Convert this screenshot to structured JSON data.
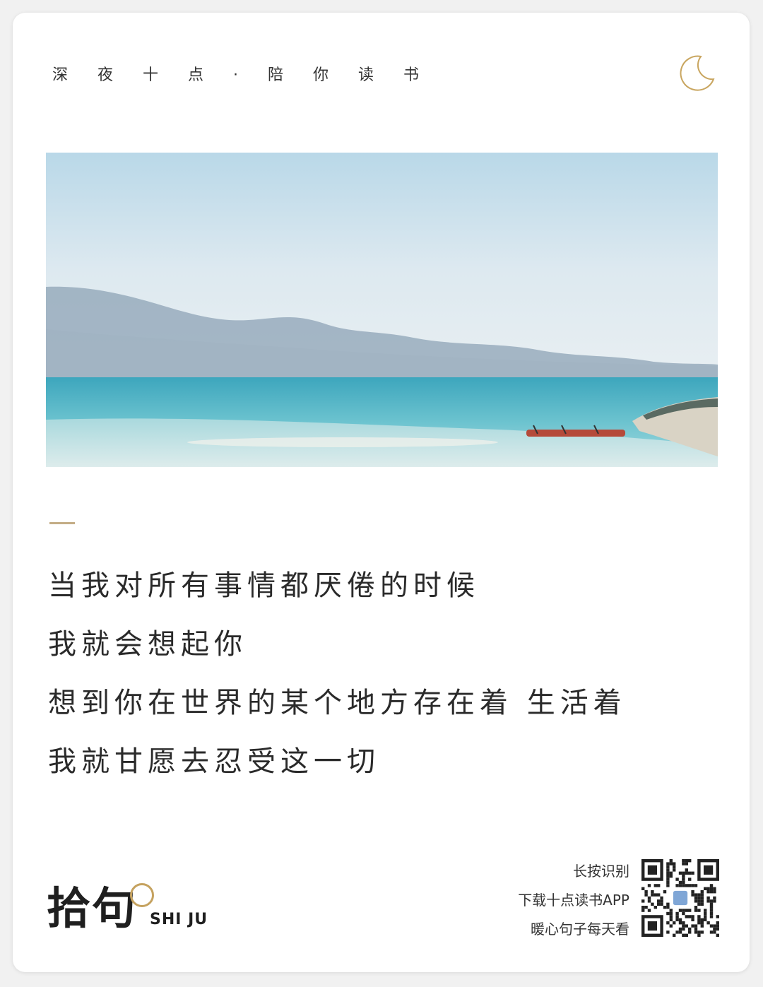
{
  "header": {
    "title": "深夜十点·陪你读书"
  },
  "quote": {
    "lines": [
      "当我对所有事情都厌倦的时候",
      "我就会想起你",
      "想到你在世界的某个地方存在着 生活着",
      "我就甘愿去忍受这一切"
    ]
  },
  "brand": {
    "name_cn": "拾句",
    "name_en": "SHI JU"
  },
  "qr_section": {
    "lines": [
      "长按识别",
      "下载十点读书APP",
      "暖心句子每天看"
    ]
  },
  "icons": {
    "moon": "moon-icon",
    "qr": "qr-code-icon"
  },
  "colors": {
    "accent_gold": "#c3ad86",
    "text": "#2a2a2a",
    "sky": "#d8e8f0",
    "sea": "#4fb3c6"
  }
}
